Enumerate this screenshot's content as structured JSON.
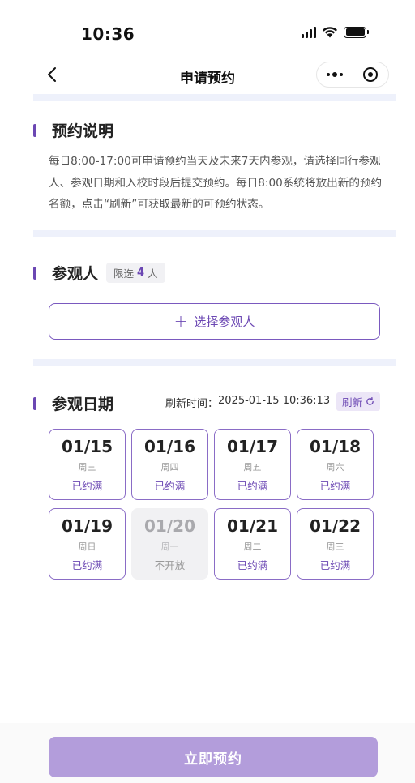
{
  "status_bar": {
    "time": "10:36"
  },
  "nav": {
    "title": "申请预约"
  },
  "intro": {
    "title": "预约说明",
    "text": "每日8:00-17:00可申请预约当天及未来7天内参观，请选择同行参观人、参观日期和入校时段后提交预约。每日8:00系统将放出新的预约名额，点击“刷新”可获取最新的可预约状态。"
  },
  "visitors": {
    "title": "参观人",
    "limit_prefix": "限选",
    "limit_count": "4",
    "limit_suffix": "人",
    "select_label": "选择参观人"
  },
  "dates": {
    "title": "参观日期",
    "refresh_label": "刷新时间：",
    "refresh_time": "2025-01-15 10:36:13",
    "refresh_button": "刷新",
    "items": [
      {
        "date": "01/15",
        "weekday": "周三",
        "status": "已约满",
        "enabled": true
      },
      {
        "date": "01/16",
        "weekday": "周四",
        "status": "已约满",
        "enabled": true
      },
      {
        "date": "01/17",
        "weekday": "周五",
        "status": "已约满",
        "enabled": true
      },
      {
        "date": "01/18",
        "weekday": "周六",
        "status": "已约满",
        "enabled": true
      },
      {
        "date": "01/19",
        "weekday": "周日",
        "status": "已约满",
        "enabled": true
      },
      {
        "date": "01/20",
        "weekday": "周一",
        "status": "不开放",
        "enabled": false
      },
      {
        "date": "01/21",
        "weekday": "周二",
        "status": "已约满",
        "enabled": true
      },
      {
        "date": "01/22",
        "weekday": "周三",
        "status": "已约满",
        "enabled": true
      }
    ]
  },
  "footer": {
    "submit_label": "立即预约"
  },
  "colors": {
    "accent": "#6b47b3",
    "submit_disabled": "#b39ddb",
    "divider": "#eef1fb"
  },
  "icons": [
    "back-icon",
    "more-icon",
    "target-icon",
    "signal-icon",
    "wifi-icon",
    "battery-icon",
    "plus-icon",
    "refresh-icon"
  ]
}
